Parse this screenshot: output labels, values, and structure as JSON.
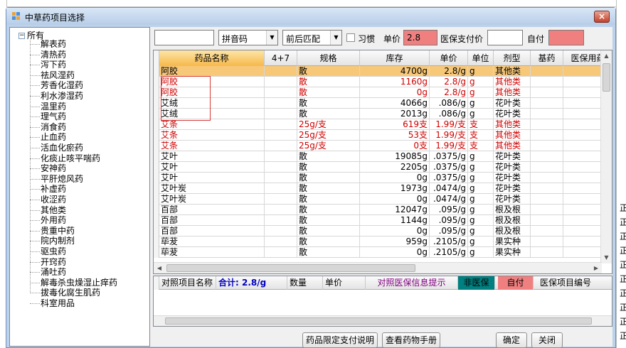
{
  "background": {
    "right_cells": [
      "正",
      "正",
      "正",
      "正",
      "正",
      "正",
      "正",
      "正",
      "正",
      "正"
    ]
  },
  "dialog": {
    "title": "中草药项目选择",
    "close": "×"
  },
  "tree": {
    "toggle": "−",
    "root": "所有",
    "items": [
      "解表药",
      "清热药",
      "泻下药",
      "祛风湿药",
      "芳香化湿药",
      "利水渗湿药",
      "温里药",
      "理气药",
      "消食药",
      "止血药",
      "活血化瘀药",
      "化痰止咳平喘药",
      "安神药",
      "平肝熄风药",
      "补虚药",
      "收涩药",
      "其他类",
      "外用药",
      "贵重中药",
      "院内制剂",
      "驱虫药",
      "开窍药",
      "涌吐药",
      "解毒杀虫燥湿止痒药",
      "拔毒化腐生肌药",
      "科室用品"
    ]
  },
  "toolbar": {
    "search_value": "",
    "pinyin": "拼音码",
    "match": "前后匹配",
    "habit_label": "习惯",
    "price_label": "单价",
    "price_value": "2.8",
    "insurance_price_label": "医保支付价",
    "insurance_price_value": "",
    "self_pay_label": "自付",
    "self_pay_value": "",
    "colors": {
      "price_bg": "#f08080",
      "self_pay_bg": "#f08080"
    }
  },
  "grid": {
    "headers": [
      "药品名称",
      "4+7",
      "规格",
      "库存",
      "单价",
      "单位",
      "剂型",
      "基药",
      "医保用药"
    ],
    "rows": [
      {
        "name": "阿胶",
        "spec": "散",
        "stock": "4700g",
        "price": "2.8/g",
        "unit": "g",
        "form": "其他类",
        "style": "selected"
      },
      {
        "name": "阿胶",
        "spec": "散",
        "stock": "1160g",
        "price": "2.8/g",
        "unit": "g",
        "form": "其他类",
        "style": "red"
      },
      {
        "name": "阿胶",
        "spec": "散",
        "stock": "0g",
        "price": "2.8/g",
        "unit": "g",
        "form": "其他类",
        "style": "red"
      },
      {
        "name": "艾绒",
        "spec": "散",
        "stock": "4066g",
        "price": ".086/g",
        "unit": "g",
        "form": "花叶类",
        "style": "normal"
      },
      {
        "name": "艾绒",
        "spec": "散",
        "stock": "2013g",
        "price": ".086/g",
        "unit": "g",
        "form": "花叶类",
        "style": "normal"
      },
      {
        "name": "艾条",
        "spec": "25g/支",
        "stock": "619支",
        "price": "1.99/支",
        "unit": "支",
        "form": "其他类",
        "style": "red"
      },
      {
        "name": "艾条",
        "spec": "25g/支",
        "stock": "53支",
        "price": "1.99/支",
        "unit": "支",
        "form": "其他类",
        "style": "red"
      },
      {
        "name": "艾条",
        "spec": "25g/支",
        "stock": "0支",
        "price": "1.99/支",
        "unit": "支",
        "form": "其他类",
        "style": "red"
      },
      {
        "name": "艾叶",
        "spec": "散",
        "stock": "19085g",
        "price": ".0375/g",
        "unit": "g",
        "form": "花叶类",
        "style": "normal"
      },
      {
        "name": "艾叶",
        "spec": "散",
        "stock": "2205g",
        "price": ".0375/g",
        "unit": "g",
        "form": "花叶类",
        "style": "normal"
      },
      {
        "name": "艾叶",
        "spec": "散",
        "stock": "0g",
        "price": ".0375/g",
        "unit": "g",
        "form": "花叶类",
        "style": "normal"
      },
      {
        "name": "艾叶炭",
        "spec": "散",
        "stock": "1973g",
        "price": ".0474/g",
        "unit": "g",
        "form": "花叶类",
        "style": "normal"
      },
      {
        "name": "艾叶炭",
        "spec": "散",
        "stock": "0g",
        "price": ".0474/g",
        "unit": "g",
        "form": "花叶类",
        "style": "normal"
      },
      {
        "name": "百部",
        "spec": "散",
        "stock": "12047g",
        "price": ".095/g",
        "unit": "g",
        "form": "根及根",
        "style": "normal"
      },
      {
        "name": "百部",
        "spec": "散",
        "stock": "1144g",
        "price": ".095/g",
        "unit": "g",
        "form": "根及根",
        "style": "normal"
      },
      {
        "name": "百部",
        "spec": "散",
        "stock": "0g",
        "price": ".095/g",
        "unit": "g",
        "form": "根及根",
        "style": "normal"
      },
      {
        "name": "荜茇",
        "spec": "散",
        "stock": "959g",
        "price": ".2105/g",
        "unit": "g",
        "form": "果实种",
        "style": "normal"
      },
      {
        "name": "荜茇",
        "spec": "散",
        "stock": "0g",
        "price": ".2105/g",
        "unit": "g",
        "form": "果实种",
        "style": "normal"
      }
    ],
    "scroll_up": "▲",
    "scroll_down": "▼",
    "scroll_left": "◀",
    "scroll_right": "▶"
  },
  "bottom": {
    "label_compare": "对照项目名称",
    "total": "合计: 2.8/g",
    "qty": "数量",
    "price": "单价",
    "hint": "对照医保信息提示",
    "non_insured": "非医保",
    "self_pay": "自付",
    "code": "医保项目编号",
    "colors": {
      "non_insured_bg": "#008080",
      "self_pay_bg": "#f08080",
      "hint_color": "#800080",
      "total_color": "#0000c0"
    }
  },
  "buttons": {
    "limit": "药品限定支付说明",
    "manual": "查看药物手册",
    "ok": "确定",
    "close": "关闭"
  }
}
